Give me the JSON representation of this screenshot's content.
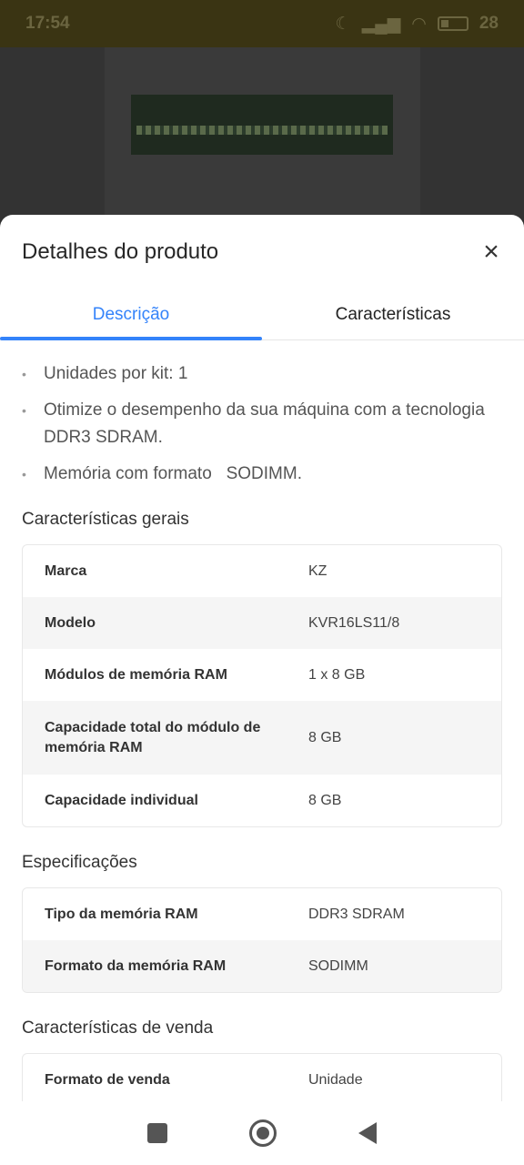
{
  "status_bar": {
    "time": "17:54",
    "battery": "28"
  },
  "sheet": {
    "title": "Detalhes do produto",
    "close_icon": "×"
  },
  "tabs": [
    {
      "label": "Descrição",
      "active": true
    },
    {
      "label": "Características",
      "active": false
    }
  ],
  "bullets": [
    "Unidades por kit: 1",
    "Otimize o desempenho da sua máquina com a tecnologia   DDR3 SDRAM.",
    "Memória com formato   SODIMM."
  ],
  "sections": {
    "gerais": {
      "title": "Características gerais",
      "rows": [
        {
          "label": "Marca",
          "value": "KZ"
        },
        {
          "label": "Modelo",
          "value": "KVR16LS11/8"
        },
        {
          "label": "Módulos de memória RAM",
          "value": "1 x 8 GB"
        },
        {
          "label": "Capacidade total do módulo de memória RAM",
          "value": "8 GB"
        },
        {
          "label": "Capacidade individual",
          "value": "8 GB"
        }
      ]
    },
    "especificacoes": {
      "title": "Especificações",
      "rows": [
        {
          "label": "Tipo da memória RAM",
          "value": "DDR3 SDRAM"
        },
        {
          "label": "Formato da memória RAM",
          "value": "SODIMM"
        }
      ]
    },
    "venda": {
      "title": "Características de venda",
      "rows": [
        {
          "label": "Formato de venda",
          "value": "Unidade"
        }
      ]
    }
  },
  "icons": {
    "nav_recent": "square-icon",
    "nav_home": "home-circle-icon",
    "nav_back": "back-triangle-icon"
  }
}
